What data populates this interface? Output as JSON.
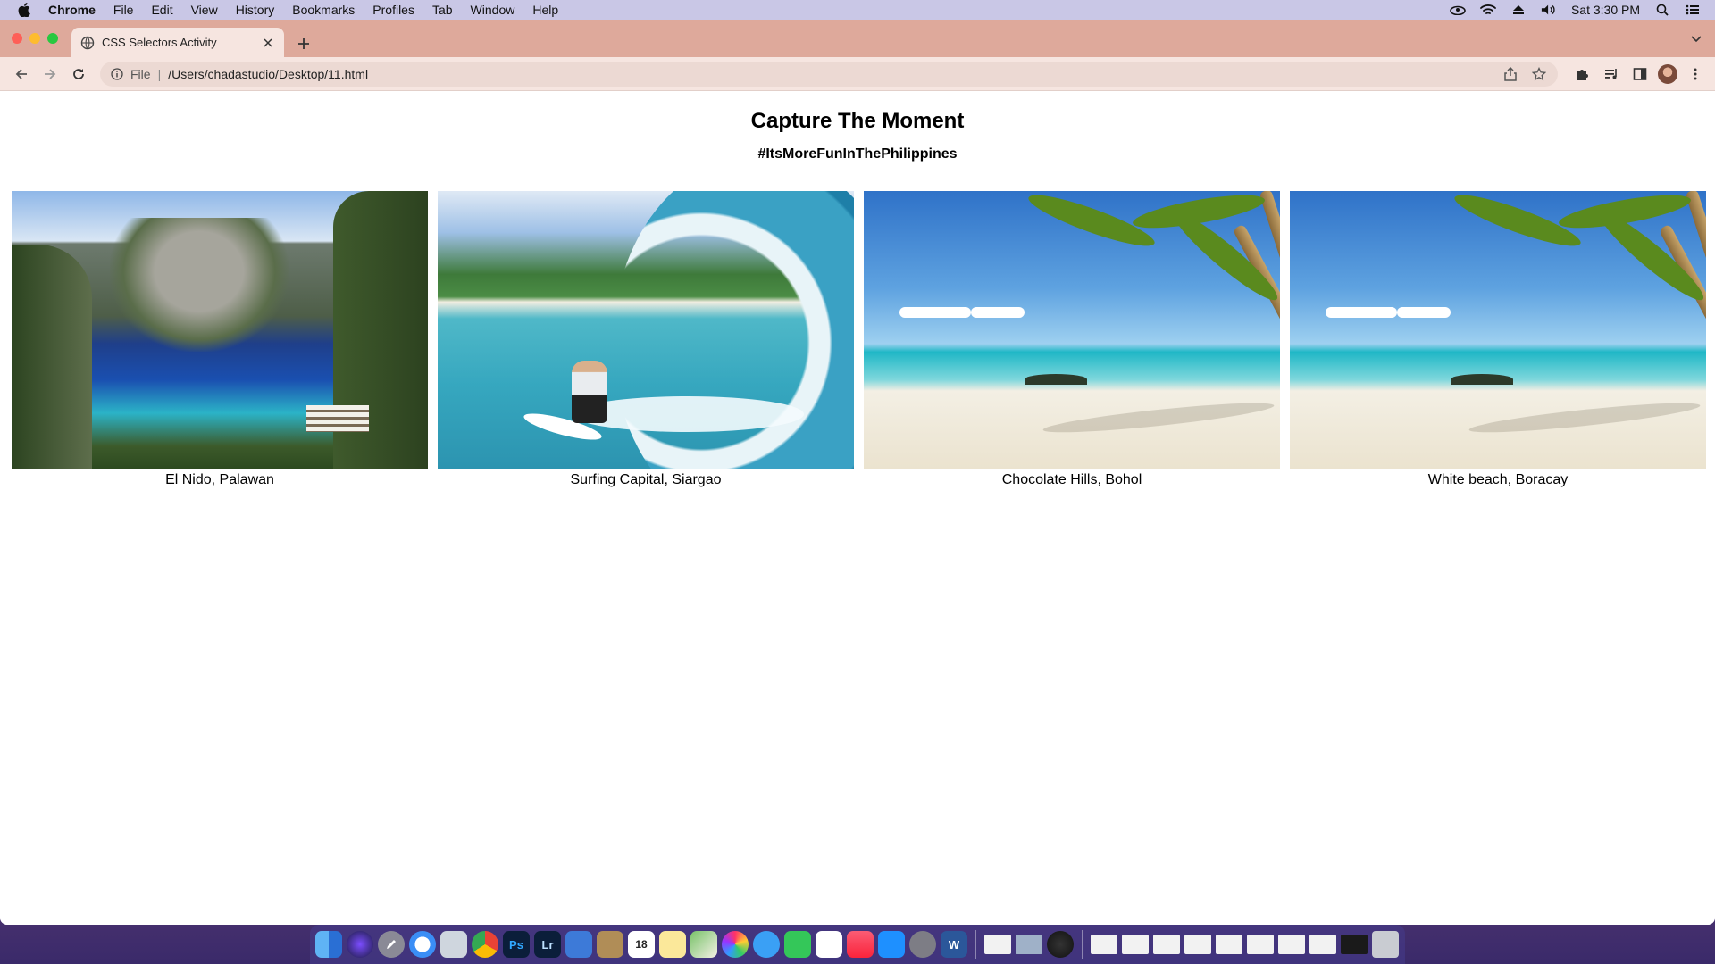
{
  "menubar": {
    "app": "Chrome",
    "menus": [
      "File",
      "Edit",
      "View",
      "History",
      "Bookmarks",
      "Profiles",
      "Tab",
      "Window",
      "Help"
    ],
    "clock": "Sat 3:30 PM"
  },
  "browser": {
    "tab_title": "CSS Selectors Activity",
    "omnibox": {
      "scheme_label": "File",
      "url": "/Users/chadastudio/Desktop/11.html"
    }
  },
  "page": {
    "title": "Capture The Moment",
    "subtitle": "#ItsMoreFunInThePhilippines",
    "gallery": [
      {
        "caption": "El Nido, Palawan",
        "scene": "lagoon-cliffs"
      },
      {
        "caption": "Surfing Capital, Siargao",
        "scene": "surfer-wave"
      },
      {
        "caption": "Chocolate Hills, Bohol",
        "scene": "palm-beach"
      },
      {
        "caption": "White beach, Boracay",
        "scene": "palm-beach"
      }
    ]
  },
  "colors": {
    "tabstrip": "#dea99b",
    "toolbar": "#f6e5e0",
    "menubar": "#c9c7e6"
  },
  "dock": {
    "apps": [
      "finder",
      "siri",
      "launchpad",
      "safari",
      "preview",
      "chrome",
      "Ps",
      "Lr",
      "image-capture",
      "notes-tan",
      "calendar",
      "notes",
      "maps",
      "photos",
      "messages",
      "facetime",
      "reminders",
      "music",
      "app-store",
      "system-preferences",
      "W"
    ],
    "calendar_date": "18"
  }
}
